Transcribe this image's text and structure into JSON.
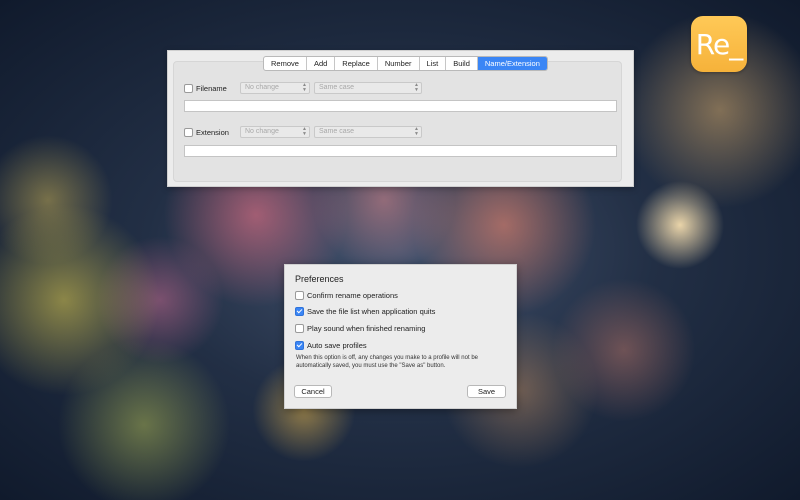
{
  "app_icon": {
    "label": "Re_",
    "color": "#f8b83e"
  },
  "rename_panel": {
    "tabs": [
      {
        "label": "Remove"
      },
      {
        "label": "Add"
      },
      {
        "label": "Replace"
      },
      {
        "label": "Number"
      },
      {
        "label": "List"
      },
      {
        "label": "Build"
      },
      {
        "label": "Name/Extension",
        "active": true
      }
    ],
    "filename": {
      "label": "Filename",
      "checked": false,
      "change_select": "No change",
      "case_select": "Same case",
      "input_value": ""
    },
    "extension": {
      "label": "Extension",
      "checked": false,
      "change_select": "No change",
      "case_select": "Same case",
      "input_value": ""
    }
  },
  "preferences": {
    "title": "Preferences",
    "options": [
      {
        "label": "Confirm rename operations",
        "checked": false
      },
      {
        "label": "Save the file list when application quits",
        "checked": true
      },
      {
        "label": "Play sound when finished renaming",
        "checked": false
      },
      {
        "label": "Auto save profiles",
        "checked": true
      }
    ],
    "note": "When this option is off, any changes you make to a profile will not be automatically saved, you must use the \"Save as\" button.",
    "cancel_label": "Cancel",
    "save_label": "Save"
  },
  "colors": {
    "accent": "#3b86f5",
    "panel_bg": "#ececec"
  }
}
